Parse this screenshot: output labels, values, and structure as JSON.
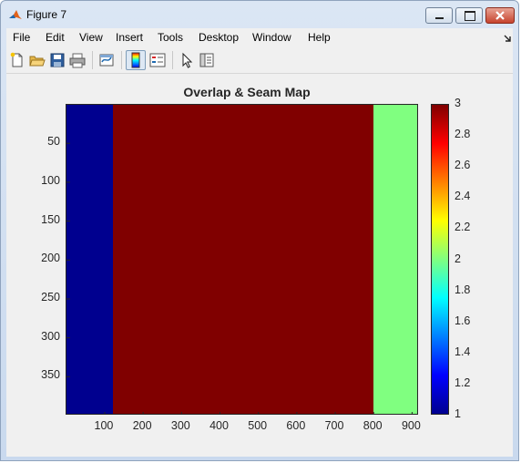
{
  "window": {
    "title": "Figure 7"
  },
  "menubar": {
    "items": [
      "File",
      "Edit",
      "View",
      "Insert",
      "Tools",
      "Desktop",
      "Window",
      "Help"
    ]
  },
  "toolbar": {
    "icons": [
      "new-figure-icon",
      "open-file-icon",
      "save-icon",
      "print-icon",
      "link-plot-icon",
      "colorbar-icon",
      "legend-icon",
      "edit-plot-arrow-icon",
      "property-inspector-icon"
    ]
  },
  "chart_data": {
    "type": "heatmap",
    "title": "Overlap & Seam Map",
    "xlabel": "",
    "ylabel": "",
    "x_ticks": [
      "100",
      "200",
      "300",
      "400",
      "500",
      "600",
      "700",
      "800",
      "900"
    ],
    "y_ticks": [
      "50",
      "100",
      "150",
      "200",
      "250",
      "300",
      "350"
    ],
    "xlim": [
      0.5,
      918
    ],
    "ylim": [
      0.5,
      400
    ],
    "y_reversed": true,
    "colormap": "jet",
    "clim": [
      1,
      3
    ],
    "colorbar_ticks": [
      "1",
      "1.2",
      "1.4",
      "1.6",
      "1.8",
      "2",
      "2.2",
      "2.4",
      "2.6",
      "2.8",
      "3"
    ],
    "regions": [
      {
        "x_from": 0.5,
        "x_to": 122,
        "value": 1,
        "color": "#00008f"
      },
      {
        "x_from": 122,
        "x_to": 800,
        "value": 3,
        "color": "#800000"
      },
      {
        "x_from": 800,
        "x_to": 918,
        "value": 2,
        "color": "#80ff80"
      }
    ]
  }
}
